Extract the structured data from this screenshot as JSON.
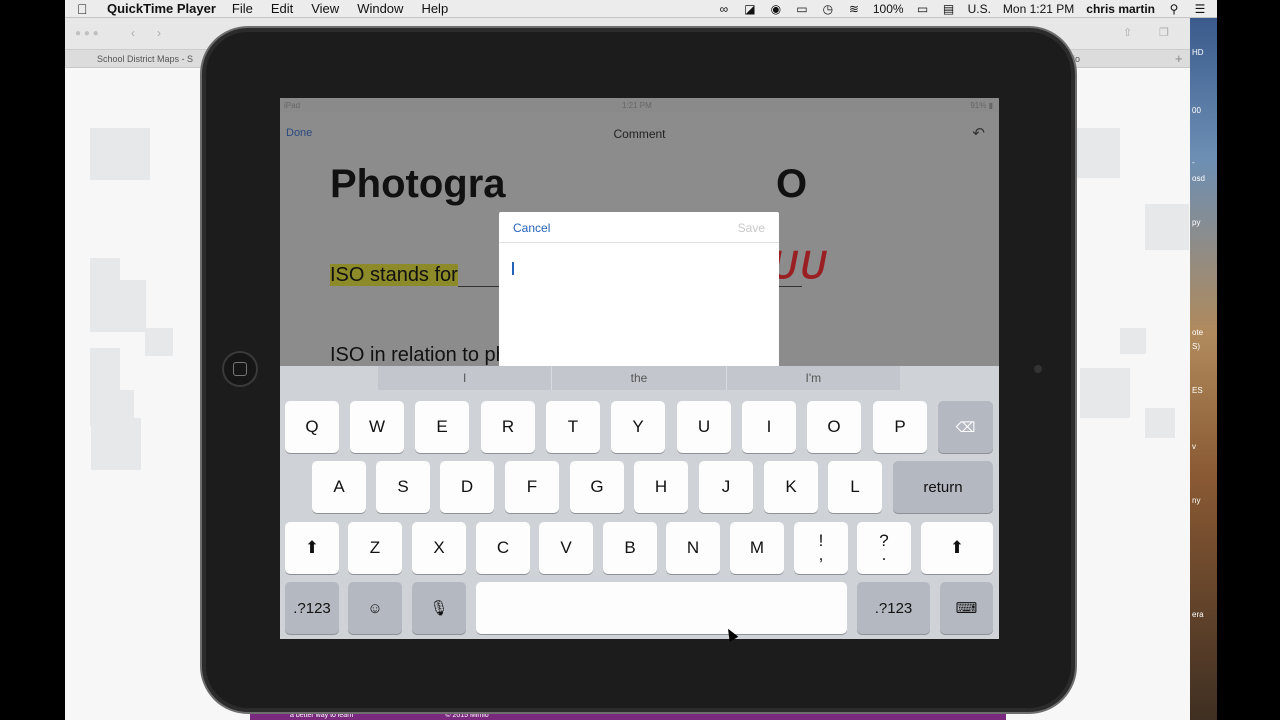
{
  "menubar": {
    "apple_icon": "apple-icon",
    "app_name": "QuickTime Player",
    "items": [
      "File",
      "Edit",
      "View",
      "Window",
      "Help"
    ],
    "battery": "100%",
    "input_source": "U.S.",
    "clock": "Mon 1:21 PM",
    "user": "chris martin"
  },
  "browser": {
    "tab_left": "School District Maps - S",
    "tab_right": "io"
  },
  "desktop_right_labels": [
    "HD",
    "00",
    "-",
    "osd",
    "py",
    "ote",
    "S)",
    "ES",
    "v",
    "ny",
    "era"
  ],
  "footer": {
    "text_left": "a better way to learn",
    "text_mid": "© 2015 Mimio"
  },
  "ipad": {
    "status": {
      "device": "iPad",
      "time": "1:21 PM",
      "battery": "91%"
    },
    "navbar": {
      "done": "Done",
      "title": "Comment",
      "undo_icon": "undo-icon"
    },
    "document": {
      "heading_left": "Photogra",
      "heading_right": "O",
      "line1_prefix": "ISO stands for",
      "handwriting": "ᴜᴜ",
      "line2": "ISO in relation to photography describes the"
    },
    "comment_popup": {
      "cancel": "Cancel",
      "save": "Save"
    },
    "keyboard": {
      "suggestions": [
        "I",
        "the",
        "I'm"
      ],
      "row1": [
        "Q",
        "W",
        "E",
        "R",
        "T",
        "Y",
        "U",
        "I",
        "O",
        "P"
      ],
      "row2": [
        "A",
        "S",
        "D",
        "F",
        "G",
        "H",
        "J",
        "K",
        "L"
      ],
      "return": "return",
      "row3": [
        "Z",
        "X",
        "C",
        "V",
        "B",
        "N",
        "M"
      ],
      "punct1_top": "!",
      "punct1_bottom": ",",
      "punct2_top": "?",
      "punct2_bottom": ".",
      "numbers_left": ".?123",
      "numbers_right": ".?123"
    }
  }
}
